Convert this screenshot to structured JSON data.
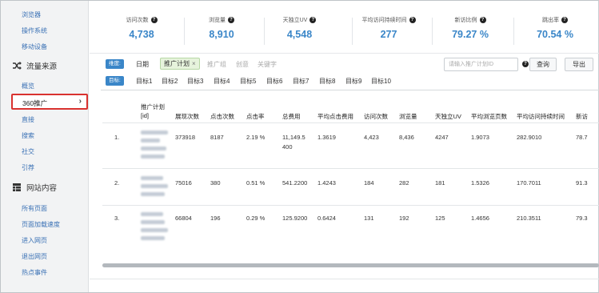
{
  "sidebar": {
    "top_items": [
      {
        "label": "浏览器"
      },
      {
        "label": "操作系统"
      },
      {
        "label": "移动设备"
      }
    ],
    "section_traffic": {
      "label": "流量来源",
      "icon": "shuffle-icon"
    },
    "traffic_items": [
      {
        "label": "概览"
      },
      {
        "label": "360推广",
        "selected": true
      },
      {
        "label": "直接"
      },
      {
        "label": "搜索"
      },
      {
        "label": "社交"
      },
      {
        "label": "引荐"
      }
    ],
    "section_content": {
      "label": "网站内容",
      "icon": "table-icon"
    },
    "content_items": [
      {
        "label": "所有页面"
      },
      {
        "label": "页面加载速度"
      },
      {
        "label": "进入网页"
      },
      {
        "label": "退出网页"
      },
      {
        "label": "热点事件"
      }
    ]
  },
  "stats": [
    {
      "label": "访问次数",
      "value": "4,738"
    },
    {
      "label": "浏览量",
      "value": "8,910"
    },
    {
      "label": "天独立UV",
      "value": "4,548"
    },
    {
      "label": "平均访问持续时间",
      "value": "277"
    },
    {
      "label": "新访比例",
      "value": "79.27 %"
    },
    {
      "label": "跳出率",
      "value": "70.54 %"
    }
  ],
  "filters": {
    "dimension_tag": "维度:",
    "date": "日期",
    "chip": "推广计划",
    "chip_close": "×",
    "gray_items": [
      "推广组",
      "创意",
      "关键字"
    ],
    "search_placeholder": "请输入推广计划ID",
    "query_button": "查询",
    "export_button": "导出",
    "target_tag": "目标:",
    "targets": [
      "目标1",
      "目标2",
      "目标3",
      "目标4",
      "目标5",
      "目标6",
      "目标7",
      "目标8",
      "目标9",
      "目标10"
    ]
  },
  "table": {
    "header_plan": "推广计划",
    "header_plan_id": "[id]",
    "headers": [
      "展现次数",
      "点击次数",
      "点击率",
      "总费用",
      "平均点击费用",
      "访问次数",
      "浏览量",
      "天独立UV",
      "平均浏览页数",
      "平均访问持续时间",
      "新访"
    ],
    "rows": [
      {
        "no": "1.",
        "cells": [
          "373918",
          "8187",
          "2.19 %",
          "11,149.5",
          "1.3619",
          "4,423",
          "8,436",
          "4247",
          "1.9073",
          "282.9010",
          "78.7"
        ],
        "cost_line2": "400"
      },
      {
        "no": "2.",
        "cells": [
          "75016",
          "380",
          "0.51 %",
          "541.2200",
          "1.4243",
          "184",
          "282",
          "181",
          "1.5326",
          "170.7011",
          "91.3"
        ]
      },
      {
        "no": "3.",
        "cells": [
          "66804",
          "196",
          "0.29 %",
          "125.9200",
          "0.6424",
          "131",
          "192",
          "125",
          "1.4656",
          "210.3511",
          "79.3"
        ]
      }
    ]
  }
}
